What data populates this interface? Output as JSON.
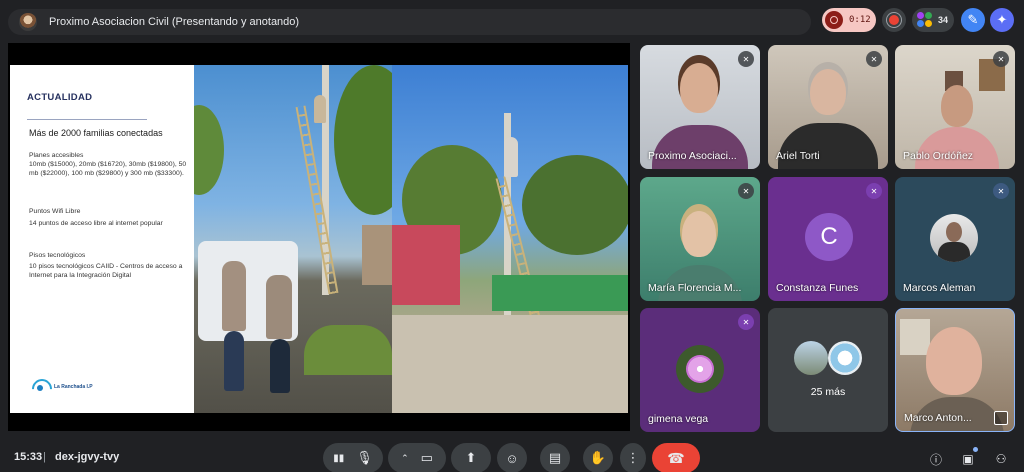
{
  "meeting": {
    "title": "Proximo Asociacion Civil (Presentando y anotando)",
    "timer": "0:12",
    "participant_count": "34",
    "clock": "15:33",
    "separator": "|",
    "code": "dex-jgvy-tvy"
  },
  "slide": {
    "heading": "ACTUALIDAD",
    "subheading": "Más de 2000 familias conectadas",
    "planes_title": "Planes accesibles",
    "planes_body": "10mb ($15000), 20mb ($16720), 30mb ($19800), 50 mb ($22000), 100 mb ($29800) y 300 mb ($33300).",
    "wifi_title": "Puntos Wifi Libre",
    "wifi_body": "14 puntos de acceso libre al internet popular",
    "pisos_title": "Pisos tecnológicos",
    "pisos_body": "10 pisos tecnológicos CAIID - Centros de acceso a Internet para la Integración Digital",
    "logo_text": "La Ranchada I.P"
  },
  "participants": [
    {
      "name": "Proximo Asociaci..."
    },
    {
      "name": "Ariel Torti"
    },
    {
      "name": "Pablo Ordóñez"
    },
    {
      "name": "María Florencia M..."
    },
    {
      "name": "Constanza Funes",
      "initial": "C"
    },
    {
      "name": "Marcos Aleman"
    },
    {
      "name": "gimena vega"
    },
    {
      "more": "25 más"
    },
    {
      "name": "Marco Anton..."
    }
  ],
  "colors": {
    "background": "#202124",
    "hangup": "#ea4335",
    "avatar_purple": "#8e58c7",
    "timer_bg": "#f6c7c3"
  },
  "icons": {
    "mic": "mic-icon",
    "camera": "camera-icon",
    "present": "present-icon",
    "emoji": "emoji-icon",
    "captions": "captions-icon",
    "hand": "raise-hand-icon",
    "more": "more-vert-icon",
    "hangup": "hangup-icon",
    "info": "info-icon",
    "chat": "chat-icon",
    "people": "people-icon"
  }
}
